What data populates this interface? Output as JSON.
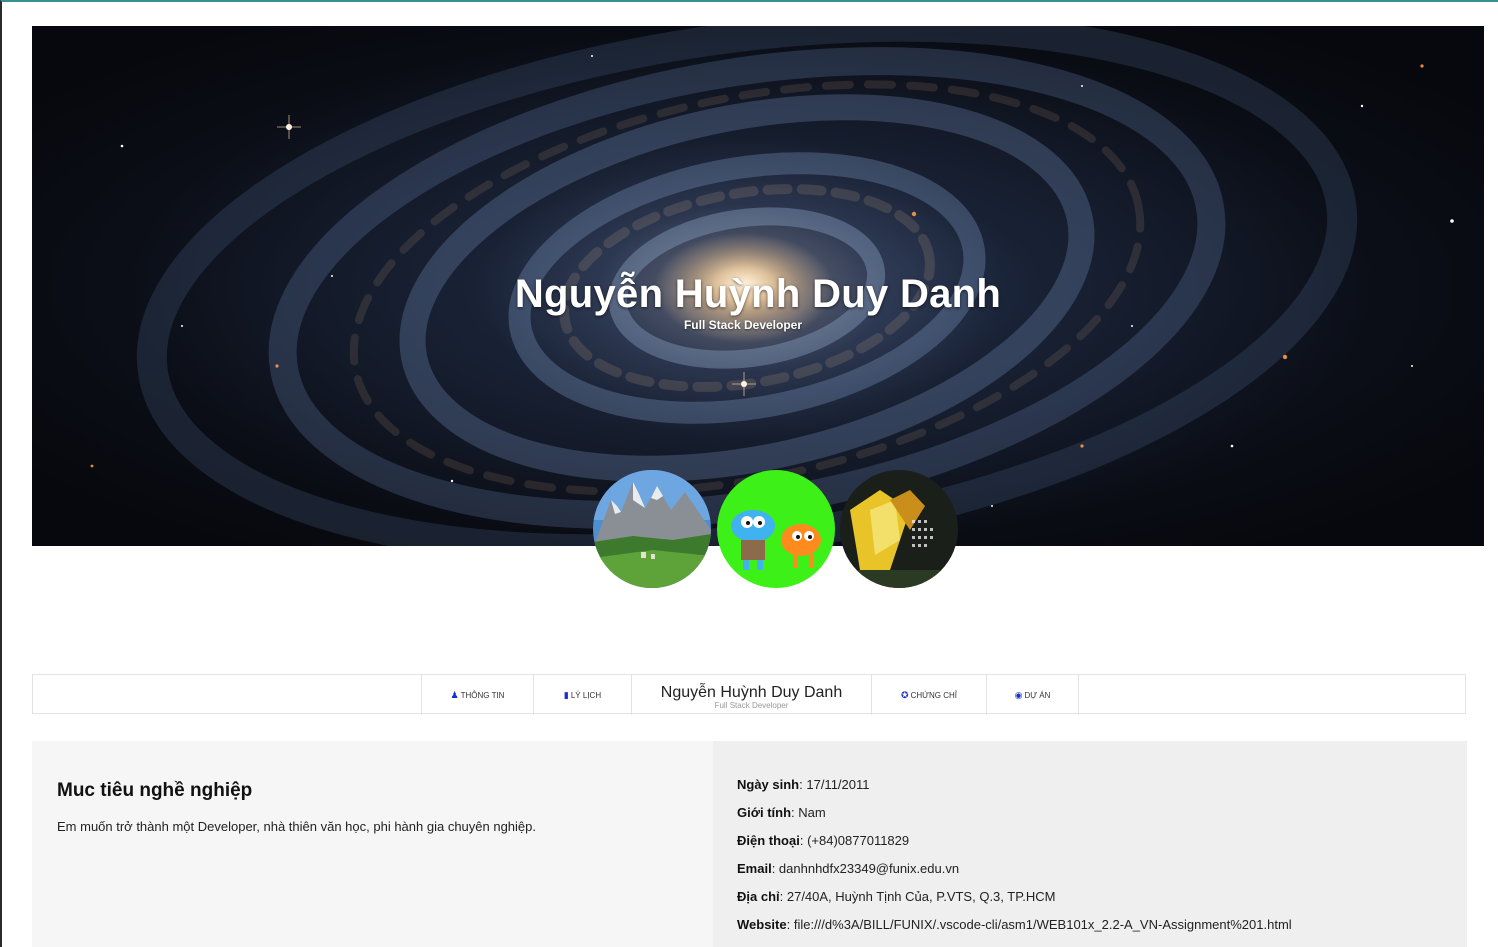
{
  "hero": {
    "name": "Nguyễn Huỳnh Duy Danh",
    "role": "Full Stack Developer"
  },
  "avatars": [
    {
      "name": "mountain-landscape"
    },
    {
      "name": "cartoon-characters"
    },
    {
      "name": "abstract-art"
    }
  ],
  "nav": {
    "info_label": "THÔNG TIN",
    "cv_label": "LÝ LỊCH",
    "brand_name": "Nguyễn Huỳnh Duy Danh",
    "brand_sub": "Full Stack Developer",
    "cert_label": "CHỨNG CHỈ",
    "projects_label": "DỰ ÁN",
    "icon_color": "#1a2fd0"
  },
  "objective": {
    "heading": "Muc tiêu nghề nghiệp",
    "text": "Em muốn trở thành một Developer, nhà thiên văn học, phi hành gia chuyên nghiệp."
  },
  "personal": [
    {
      "label": "Ngày sinh",
      "value": "17/11/2011"
    },
    {
      "label": "Giới tính",
      "value": "Nam"
    },
    {
      "label": "Điện thoại",
      "value": "(+84)0877011829"
    },
    {
      "label": "Email",
      "value": "danhnhdfx23349@funix.edu.vn"
    },
    {
      "label": "Địa chỉ",
      "value": "27/40A, Huỳnh Tịnh Của, P.VTS, Q.3, TP.HCM"
    },
    {
      "label": "Website",
      "value": "file:///d%3A/BILL/FUNIX/.vscode-cli/asm1/WEB101x_2.2-A_VN-Assignment%201.html"
    }
  ]
}
